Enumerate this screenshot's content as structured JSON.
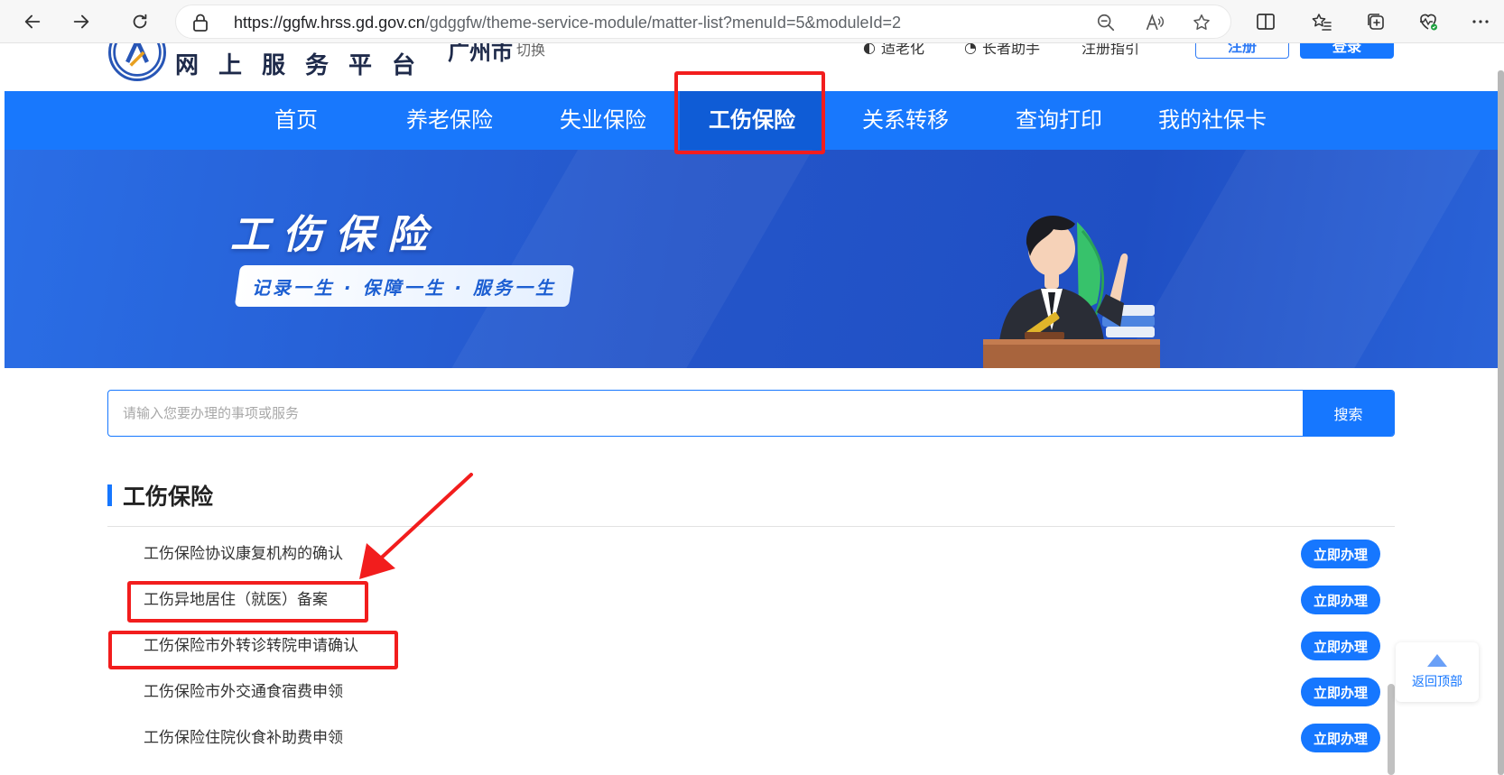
{
  "browser": {
    "url_host": "https://ggfw.hrss.gd.gov.cn",
    "url_path": "/gdggfw/theme-service-module/matter-list?menuId=5&moduleId=2"
  },
  "header": {
    "platform_name": "网上服务平台",
    "city": "广州市",
    "switch_label": "切换",
    "links": [
      "适老化",
      "长者助手",
      "注册指引"
    ],
    "register_label": "注册",
    "login_label": "登录"
  },
  "nav": {
    "items": [
      {
        "label": "首页",
        "active": false
      },
      {
        "label": "养老保险",
        "active": false
      },
      {
        "label": "失业保险",
        "active": false
      },
      {
        "label": "工伤保险",
        "active": true
      },
      {
        "label": "关系转移",
        "active": false
      },
      {
        "label": "查询打印",
        "active": false
      },
      {
        "label": "我的社保卡",
        "active": false
      }
    ]
  },
  "banner": {
    "title": "工伤保险",
    "slogan": "记录一生 · 保障一生 · 服务一生"
  },
  "search": {
    "placeholder": "请输入您要办理的事项或服务",
    "button_label": "搜索"
  },
  "section": {
    "title": "工伤保险"
  },
  "matters": [
    {
      "name": "工伤保险协议康复机构的确认",
      "action": "立即办理"
    },
    {
      "name": "工伤异地居住（就医）备案",
      "action": "立即办理"
    },
    {
      "name": "工伤保险市外转诊转院申请确认",
      "action": "立即办理"
    },
    {
      "name": "工伤保险市外交通食宿费申领",
      "action": "立即办理"
    },
    {
      "name": "工伤保险住院伙食补助费申领",
      "action": "立即办理"
    }
  ],
  "back_to_top": "返回顶部",
  "colors": {
    "primary": "#1677ff",
    "nav_bg": "#1878fd",
    "annotation_red": "#f21d1d"
  }
}
